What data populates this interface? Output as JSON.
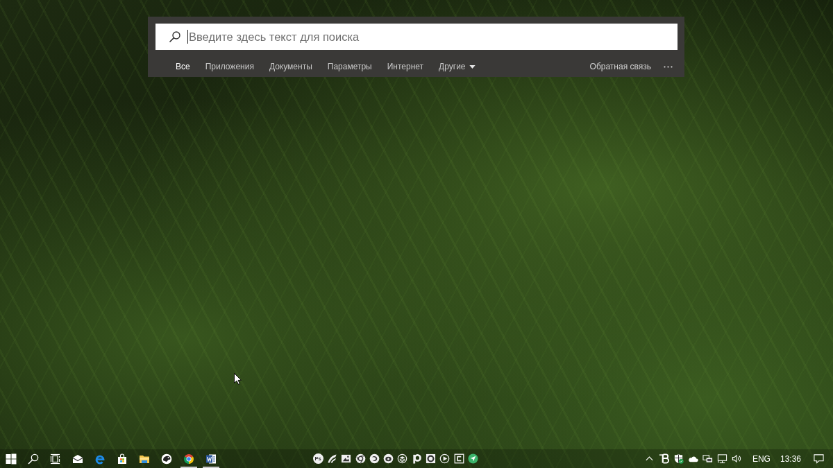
{
  "search_panel": {
    "placeholder": "Введите здесь текст для поиска",
    "tabs": [
      {
        "label": "Все",
        "selected": true,
        "kind": "filter"
      },
      {
        "label": "Приложения",
        "selected": false,
        "kind": "filter"
      },
      {
        "label": "Документы",
        "selected": false,
        "kind": "filter"
      },
      {
        "label": "Параметры",
        "selected": false,
        "kind": "filter"
      },
      {
        "label": "Интернет",
        "selected": false,
        "kind": "filter"
      },
      {
        "label": "Другие",
        "selected": false,
        "kind": "dropdown"
      }
    ],
    "feedback": "Обратная связь"
  },
  "taskbar": {
    "pinned_apps": [
      {
        "kind": "mail",
        "running": false
      },
      {
        "kind": "edge",
        "running": false
      },
      {
        "kind": "store",
        "running": false
      },
      {
        "kind": "explorer",
        "running": false
      },
      {
        "kind": "round-app",
        "running": false
      },
      {
        "kind": "chrome",
        "running": true
      },
      {
        "kind": "word",
        "running": true
      }
    ],
    "toolbar": [
      {
        "kind": "ps",
        "glyph": "Ps"
      },
      {
        "kind": "wing"
      },
      {
        "kind": "image"
      },
      {
        "kind": "ring"
      },
      {
        "kind": "swirl"
      },
      {
        "kind": "disc"
      },
      {
        "kind": "layers"
      },
      {
        "kind": "p"
      },
      {
        "kind": "square-ring"
      },
      {
        "kind": "play"
      },
      {
        "kind": "c-square"
      },
      {
        "kind": "send"
      }
    ],
    "language": "ENG",
    "clock": "13:36"
  }
}
